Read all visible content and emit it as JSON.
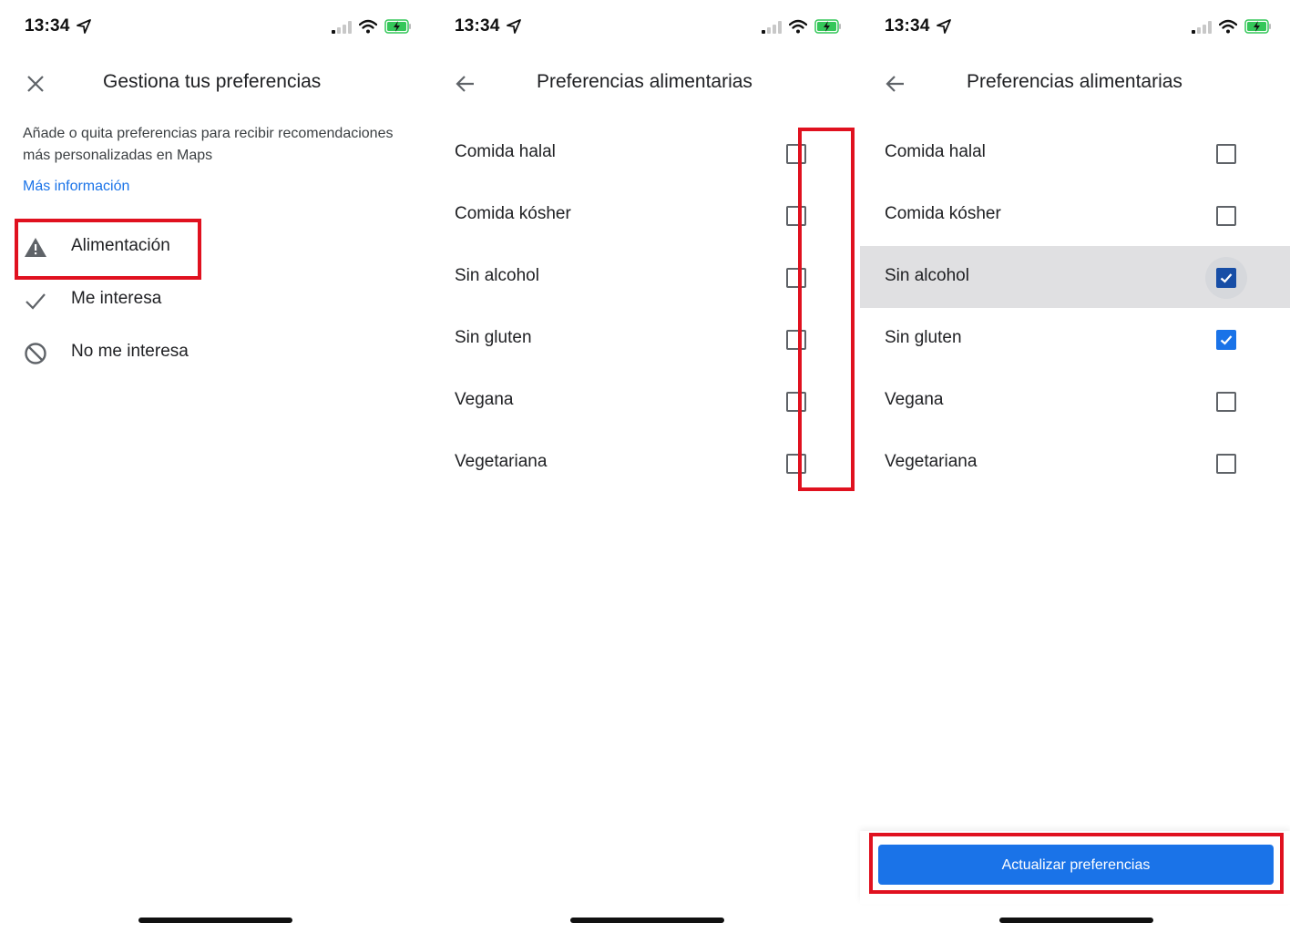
{
  "status_bar": {
    "time": "13:34"
  },
  "screen1": {
    "title": "Gestiona tus preferencias",
    "description": "Añade o quita preferencias para recibir recomendaciones más personalizadas en Maps",
    "more_info_link": "Más información",
    "menu": [
      {
        "label": "Alimentación",
        "icon": "warning-icon",
        "highlighted": true
      },
      {
        "label": "Me interesa",
        "icon": "check-icon"
      },
      {
        "label": "No me interesa",
        "icon": "block-icon"
      }
    ]
  },
  "screen2": {
    "title": "Preferencias alimentarias",
    "options": [
      {
        "label": "Comida halal",
        "checked": false
      },
      {
        "label": "Comida kósher",
        "checked": false
      },
      {
        "label": "Sin alcohol",
        "checked": false
      },
      {
        "label": "Sin gluten",
        "checked": false
      },
      {
        "label": "Vegana",
        "checked": false
      },
      {
        "label": "Vegetariana",
        "checked": false
      }
    ]
  },
  "screen3": {
    "title": "Preferencias alimentarias",
    "options": [
      {
        "label": "Comida halal",
        "checked": false
      },
      {
        "label": "Comida kósher",
        "checked": false
      },
      {
        "label": "Sin alcohol",
        "checked": true,
        "pressed": true
      },
      {
        "label": "Sin gluten",
        "checked": true
      },
      {
        "label": "Vegana",
        "checked": false
      },
      {
        "label": "Vegetariana",
        "checked": false
      }
    ],
    "action_button": "Actualizar preferencias"
  },
  "colors": {
    "accent": "#1a73e8",
    "annotation_red": "#e0111f",
    "battery_green": "#34c759"
  }
}
